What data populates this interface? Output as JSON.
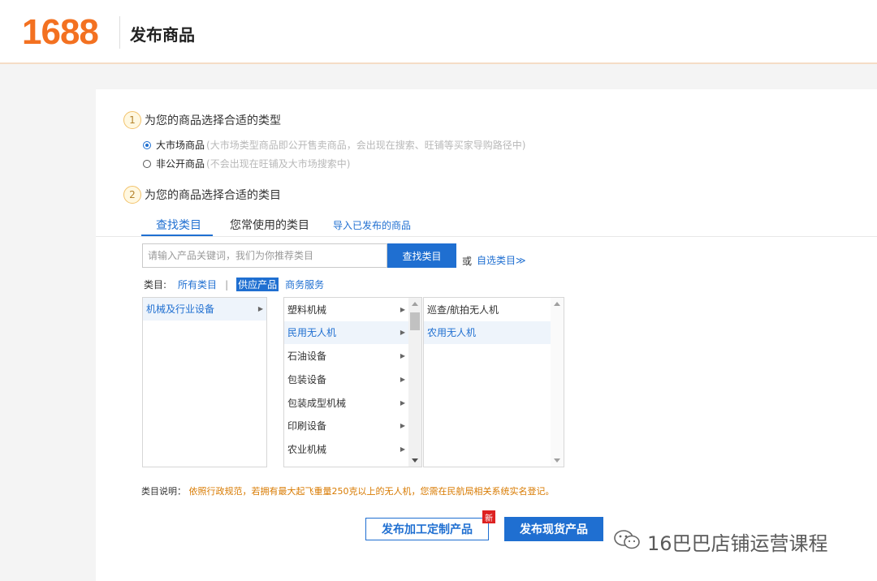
{
  "header": {
    "logo": "1688",
    "title": "发布商品"
  },
  "step1": {
    "num": "1",
    "title": "为您的商品选择合适的类型",
    "options": [
      {
        "label": "大市场商品",
        "hint": "(大市场类型商品即公开售卖商品，会出现在搜索、旺铺等买家导购路径中)",
        "checked": true
      },
      {
        "label": "非公开商品",
        "hint": "(不会出现在旺铺及大市场搜索中)",
        "checked": false
      }
    ]
  },
  "step2": {
    "num": "2",
    "title": "为您的商品选择合适的类目"
  },
  "tabs": [
    {
      "label": "查找类目",
      "active": true
    },
    {
      "label": "您常使用的类目",
      "active": false
    },
    {
      "label": "导入已发布的商品",
      "active": false
    }
  ],
  "search": {
    "placeholder": "请输入产品关键词，我们为你推荐类目",
    "button": "查找类目",
    "or": "或",
    "self_select": "自选类目≫"
  },
  "filter": {
    "label": "类目:",
    "all": "所有类目",
    "sep": "|",
    "supply": "供应产品",
    "service": "商务服务"
  },
  "columns": {
    "level1": [
      {
        "label": "机械及行业设备",
        "selected": true
      }
    ],
    "level2": [
      {
        "label": "塑料机械",
        "selected": false
      },
      {
        "label": "民用无人机",
        "selected": true
      },
      {
        "label": "石油设备",
        "selected": false
      },
      {
        "label": "包装设备",
        "selected": false
      },
      {
        "label": "包装成型机械",
        "selected": false
      },
      {
        "label": "印刷设备",
        "selected": false
      },
      {
        "label": "农业机械",
        "selected": false
      }
    ],
    "level3": [
      {
        "label": "巡查/航拍无人机",
        "selected": false
      },
      {
        "label": "农用无人机",
        "selected": true
      }
    ]
  },
  "description": {
    "label": "类目说明：",
    "text": "依照行政规范，若拥有最大起飞重量250克以上的无人机，您需在民航局相关系统实名登记。"
  },
  "buttons": {
    "custom": "发布加工定制产品",
    "new_badge": "新",
    "stock": "发布现货产品"
  },
  "watermark": "16巴巴店铺运营课程",
  "colors": {
    "brand": "#f37121",
    "accent": "#1f6fd1",
    "warning": "#d87a00"
  }
}
